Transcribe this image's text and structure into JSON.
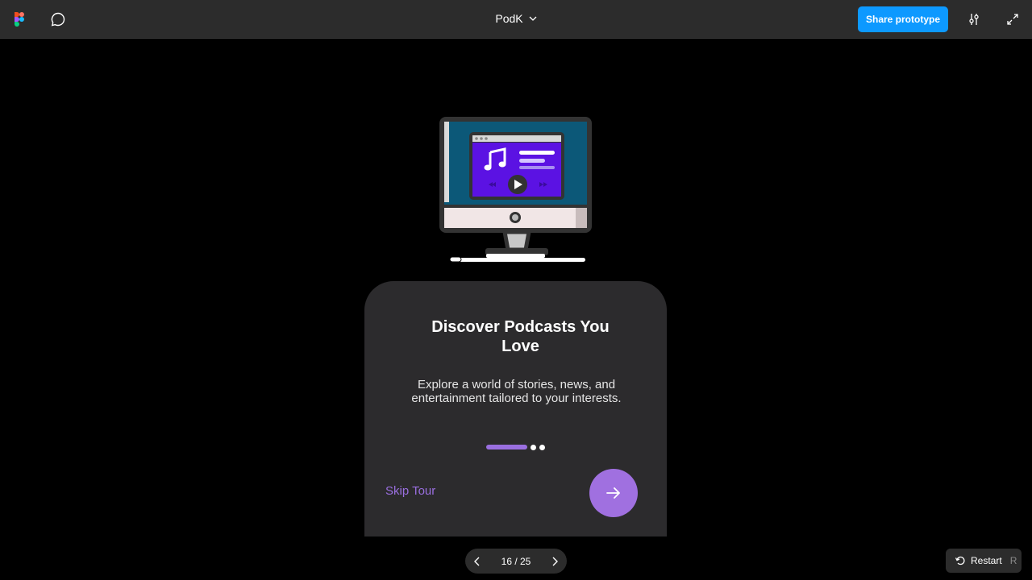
{
  "toolbar": {
    "file_title": "PodK",
    "share_label": "Share prototype",
    "icons": [
      "figma-logo-icon",
      "comment-icon",
      "chevron-down-icon",
      "settings-sliders-icon",
      "expand-icon"
    ]
  },
  "card": {
    "title": "Discover Podcasts You Love",
    "body": "Explore a world of stories, news, and entertainment tailored to your interests.",
    "skip_label": "Skip Tour",
    "pagination": {
      "total": 3,
      "active": 1
    }
  },
  "pager": {
    "position": "16 / 25"
  },
  "restart": {
    "label": "Restart",
    "shortcut": "R"
  },
  "colors": {
    "accent": "#9a6fe0",
    "share_blue": "#0d99ff",
    "card_bg": "#2c2b2d",
    "toolbar_bg": "#2c2c2c",
    "screen_purple": "#5b12e3",
    "screen_teal": "#0c5878"
  }
}
